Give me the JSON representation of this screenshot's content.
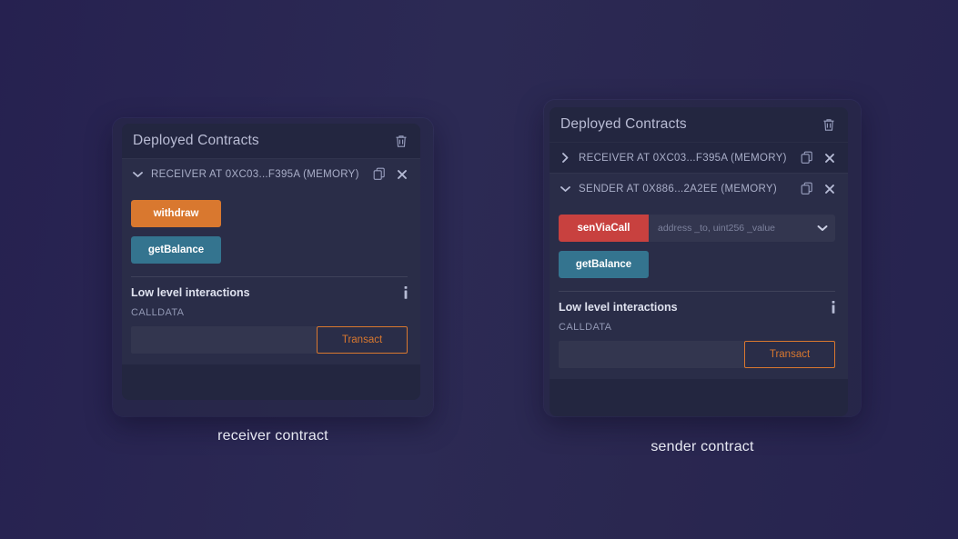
{
  "background": {
    "from": "#262150",
    "to": "#262350"
  },
  "colors": {
    "card_bg": "#232640",
    "instance_bg": "#2a2d48",
    "input_bg": "#33364f",
    "orange": "#d9782f",
    "teal": "#34748f",
    "red": "#c8413f",
    "title_text": "#b9bcd4",
    "muted_text": "#a9aec8"
  },
  "left_card": {
    "header": {
      "title": "Deployed Contracts",
      "delete_icon": "trash-icon"
    },
    "instances": [
      {
        "expanded": true,
        "chevron": "chevron-down-icon",
        "label": "RECEIVER AT 0XC03...F395A (MEMORY)",
        "copy_icon": "copy-icon",
        "close_icon": "close-icon",
        "functions": [
          {
            "name": "withdraw",
            "style": "orange",
            "has_input": false
          },
          {
            "name": "getBalance",
            "style": "teal",
            "has_input": false
          }
        ],
        "low_level": {
          "title": "Low level interactions",
          "info_icon": "info-icon",
          "calldata_label": "CALLDATA",
          "calldata_value": "",
          "calldata_placeholder": "",
          "transact_label": "Transact"
        }
      }
    ],
    "caption": "receiver contract"
  },
  "right_card": {
    "header": {
      "title": "Deployed Contracts",
      "delete_icon": "trash-icon"
    },
    "instances": [
      {
        "expanded": false,
        "chevron": "chevron-right-icon",
        "label": "RECEIVER AT 0XC03...F395A (MEMORY)",
        "copy_icon": "copy-icon",
        "close_icon": "close-icon"
      },
      {
        "expanded": true,
        "chevron": "chevron-down-icon",
        "label": "SENDER AT 0X886...2A2EE (MEMORY)",
        "copy_icon": "copy-icon",
        "close_icon": "close-icon",
        "functions": [
          {
            "name": "senViaCall",
            "style": "red",
            "has_input": true,
            "input_value": "",
            "input_placeholder": "address _to, uint256 _value",
            "caret_icon": "chevron-down-icon"
          },
          {
            "name": "getBalance",
            "style": "teal",
            "has_input": false
          }
        ],
        "low_level": {
          "title": "Low level interactions",
          "info_icon": "info-icon",
          "calldata_label": "CALLDATA",
          "calldata_value": "",
          "calldata_placeholder": "",
          "transact_label": "Transact"
        }
      }
    ],
    "caption": "sender contract"
  }
}
